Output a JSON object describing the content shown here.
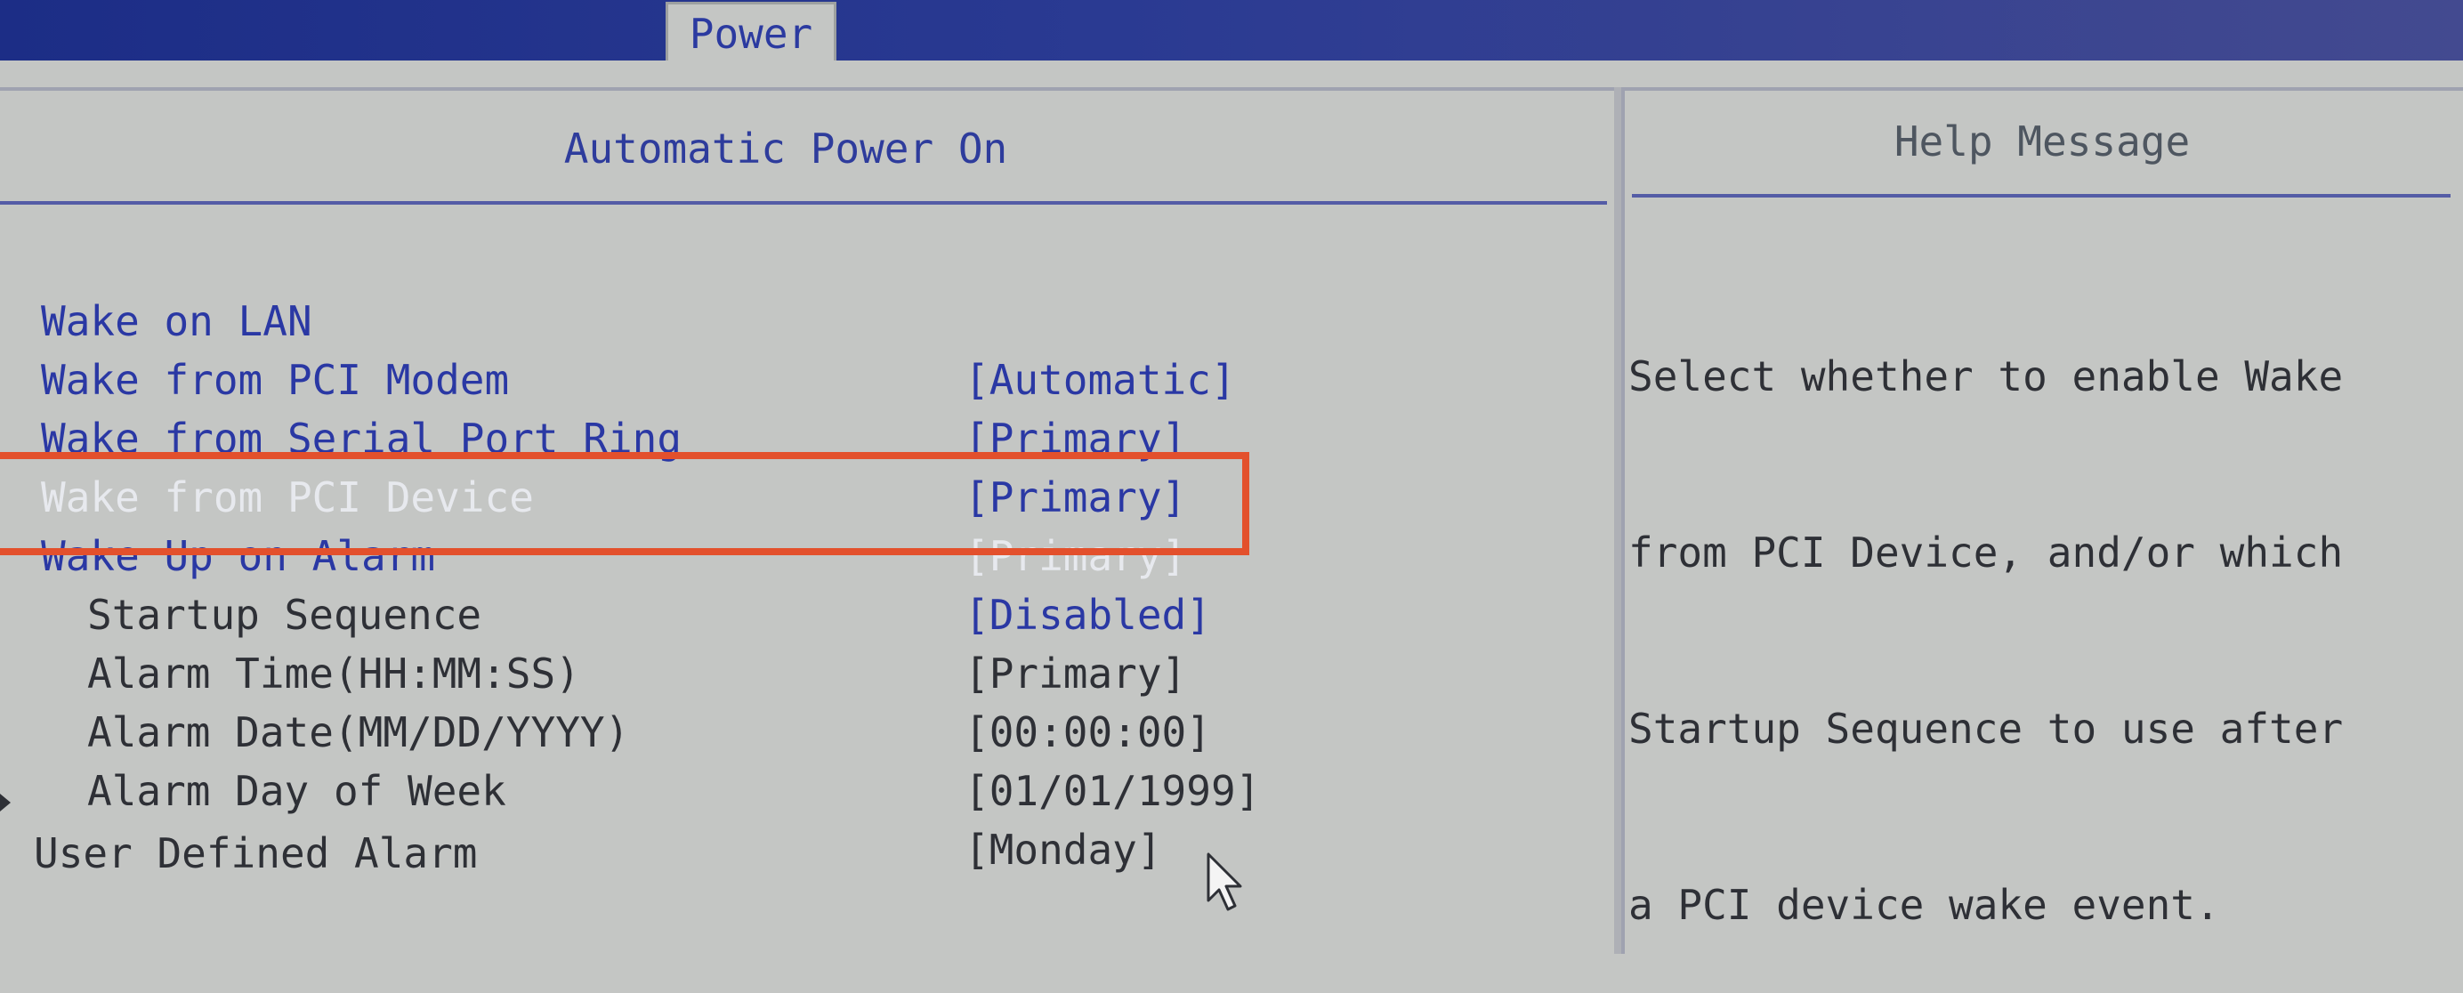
{
  "tabs": {
    "active": "Power"
  },
  "left_panel": {
    "title": "Automatic Power On",
    "items": [
      {
        "label": "Wake on LAN",
        "value": "[Automatic]"
      },
      {
        "label": "Wake from PCI Modem",
        "value": "[Primary]"
      },
      {
        "label": "Wake from Serial Port Ring",
        "value": "[Primary]"
      },
      {
        "label": "Wake from PCI Device",
        "value": "[Primary]"
      },
      {
        "label": "Wake Up on Alarm",
        "value": "[Disabled]"
      },
      {
        "label": "Startup Sequence",
        "value": "[Primary]"
      },
      {
        "label": "Alarm Time(HH:MM:SS)",
        "value": "[00:00:00]"
      },
      {
        "label": "Alarm Date(MM/DD/YYYY)",
        "value": "[01/01/1999]"
      },
      {
        "label": "Alarm Day of Week",
        "value": "[Monday]"
      },
      {
        "label": "User Defined Alarm"
      }
    ]
  },
  "help_panel": {
    "title": "Help Message",
    "lines": [
      "Select whether to enable Wake",
      "from PCI Device, and/or which",
      "Startup Sequence to use after",
      "a PCI device wake event."
    ]
  },
  "colors": {
    "background": "#c4c6c4",
    "top_bar": "#1c2d86",
    "item_blue": "#2a38a4",
    "item_dark": "#2e3036",
    "highlight_box": "#e3502c"
  },
  "icons": {
    "submenu": "triangle-right-icon",
    "pointer": "mouse-pointer-icon"
  }
}
